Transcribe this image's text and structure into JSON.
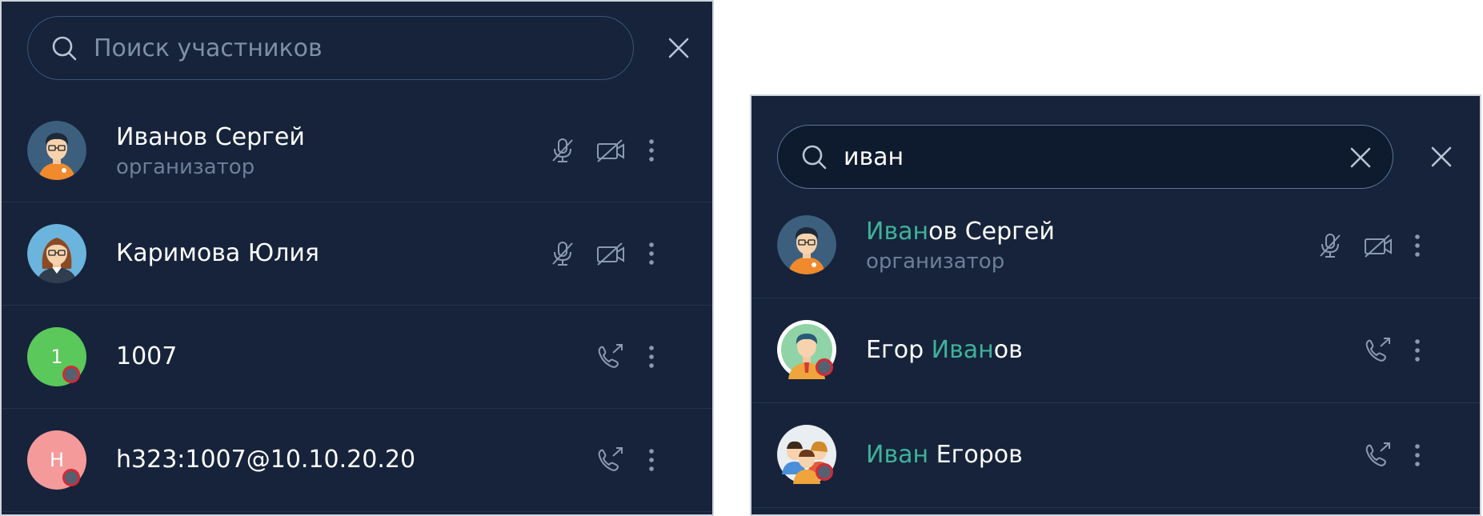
{
  "left_panel": {
    "search": {
      "placeholder": "Поиск участников",
      "icon": "search-icon"
    },
    "close_icon": "close-icon",
    "participants": [
      {
        "name": "Иванов Сергей",
        "role": "организатор",
        "avatar": "man-avatar",
        "actions": [
          "mic-off-icon",
          "camera-off-icon",
          "more-icon"
        ]
      },
      {
        "name": "Каримова Юлия",
        "avatar": "woman-avatar",
        "actions": [
          "mic-off-icon",
          "camera-off-icon",
          "more-icon"
        ]
      },
      {
        "name": "1007",
        "avatar_letter": "1",
        "avatar_color": "#5ac85a",
        "status": "offline",
        "actions": [
          "call-icon",
          "more-icon"
        ]
      },
      {
        "name": "h323:1007@10.10.20.20",
        "avatar_letter": "H",
        "avatar_color": "#f59a9a",
        "status": "offline",
        "actions": [
          "call-icon",
          "more-icon"
        ]
      }
    ]
  },
  "right_panel": {
    "search": {
      "value": "иван",
      "icon": "search-icon",
      "clear_icon": "clear-icon"
    },
    "close_icon": "close-icon",
    "results": [
      {
        "name_match": "Иван",
        "name_rest": "ов Сергей",
        "role": "организатор",
        "avatar": "man-avatar",
        "actions": [
          "mic-off-icon",
          "camera-off-icon",
          "more-icon"
        ]
      },
      {
        "name_pre": "Егор ",
        "name_match": "Иван",
        "name_rest": "ов",
        "avatar": "man-tie-avatar",
        "status": "offline",
        "actions": [
          "call-icon",
          "more-icon"
        ]
      },
      {
        "name_match": "Иван",
        "name_rest": " Егоров",
        "avatar": "group-avatar",
        "status": "offline",
        "actions": [
          "call-icon",
          "more-icon"
        ]
      }
    ]
  },
  "colors": {
    "background": "#16233b",
    "highlight": "#3fb29a",
    "secondary_text": "#6e7f98",
    "status_ring": "#d22a38"
  }
}
